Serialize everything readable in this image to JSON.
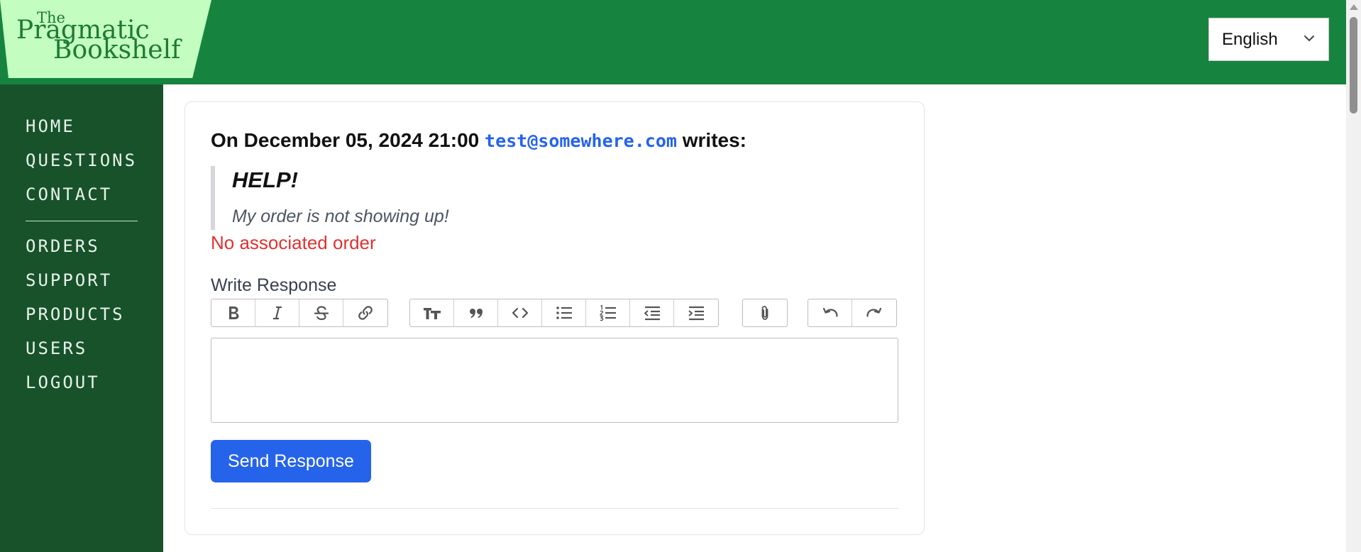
{
  "header": {
    "logo": {
      "line1": "The",
      "line2": "Pragmatic",
      "line3": "Bookshelf"
    },
    "language": {
      "selected": "English"
    }
  },
  "sidebar": {
    "items": [
      {
        "label": "HOME"
      },
      {
        "label": "QUESTIONS"
      },
      {
        "label": "CONTACT"
      },
      {
        "label": "ORDERS"
      },
      {
        "label": "SUPPORT"
      },
      {
        "label": "PRODUCTS"
      },
      {
        "label": "USERS"
      },
      {
        "label": "LOGOUT"
      }
    ]
  },
  "post": {
    "prefix": "On December 05, 2024 21:00",
    "author_email": "test@somewhere.com",
    "suffix": "writes:",
    "title": "HELP!",
    "body": "My order is not showing up!",
    "order_status": "No associated order"
  },
  "response": {
    "label": "Write Response",
    "send_label": "Send Response"
  },
  "toolbar": {
    "groups": [
      [
        "bold-icon",
        "italic-icon",
        "strikethrough-icon",
        "link-icon"
      ],
      [
        "heading-icon",
        "quote-icon",
        "code-icon",
        "bullet-list-icon",
        "numbered-list-icon",
        "outdent-icon",
        "indent-icon"
      ],
      [
        "attach-icon"
      ],
      [
        "undo-icon",
        "redo-icon"
      ]
    ]
  },
  "colors": {
    "header_bg": "#16843f",
    "sidebar_bg": "#17522a",
    "logo_bg": "#c3fdc0",
    "accent": "#2563eb",
    "error": "#e03131"
  }
}
